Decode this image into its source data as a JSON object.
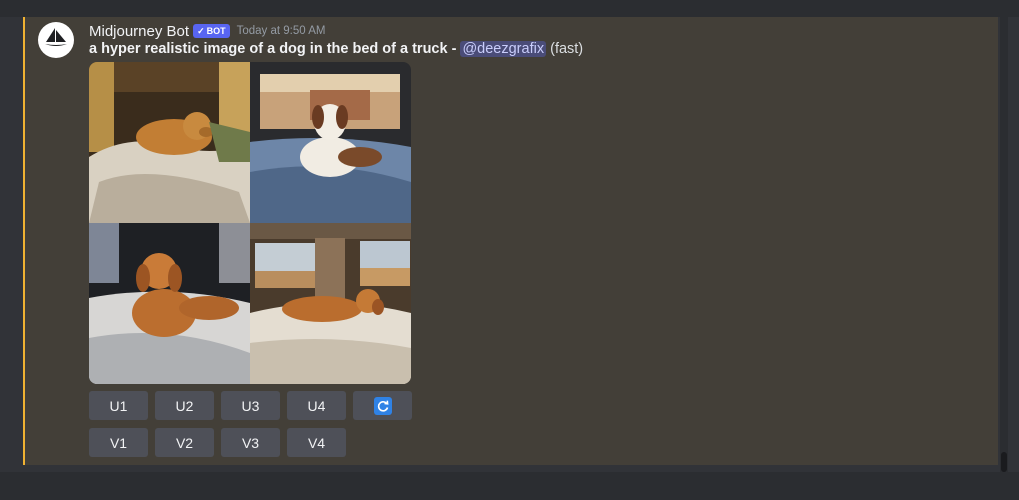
{
  "message": {
    "author": "Midjourney Bot",
    "badge": "BOT",
    "timestamp": "Today at 9:50 AM",
    "prompt": "a hyper realistic image of a dog in the bed of a truck",
    "separator": " - ",
    "mention": "@deezgrafix",
    "speed": "(fast)",
    "avatar_icon": "sailboat-icon",
    "accent_color": "#f0b232"
  },
  "images": [
    {
      "name": "dog-image-1",
      "desc_icon": "image"
    },
    {
      "name": "dog-image-2",
      "desc_icon": "image"
    },
    {
      "name": "dog-image-3",
      "desc_icon": "image"
    },
    {
      "name": "dog-image-4",
      "desc_icon": "image"
    }
  ],
  "buttons": {
    "upscale": [
      "U1",
      "U2",
      "U3",
      "U4"
    ],
    "reroll_icon": "refresh-icon",
    "variation": [
      "V1",
      "V2",
      "V3",
      "V4"
    ]
  }
}
